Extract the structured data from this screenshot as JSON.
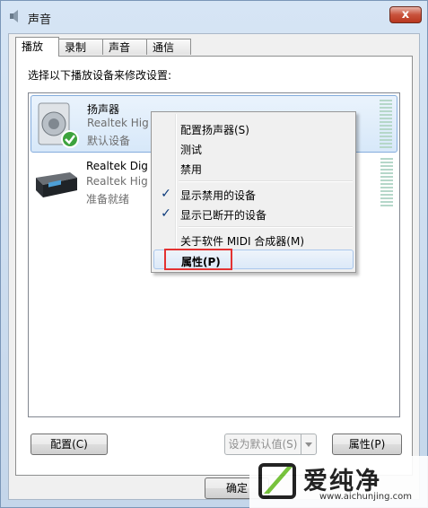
{
  "window": {
    "title": "声音",
    "close_label": "x"
  },
  "tabs": [
    {
      "label": "播放",
      "active": true
    },
    {
      "label": "录制",
      "active": false
    },
    {
      "label": "声音",
      "active": false
    },
    {
      "label": "通信",
      "active": false
    }
  ],
  "panel": {
    "instruction": "选择以下播放设备来修改设置:"
  },
  "devices": [
    {
      "name": "扬声器",
      "description": "Realtek Hig",
      "status": "默认设备",
      "selected": true,
      "icon": "speaker-icon"
    },
    {
      "name": "Realtek Dig",
      "description": "Realtek Hig",
      "status": "准备就绪",
      "selected": false,
      "icon": "digital-output-icon"
    }
  ],
  "context_menu": {
    "items": [
      {
        "label": "配置扬声器(S)",
        "checked": false
      },
      {
        "label": "测试",
        "checked": false
      },
      {
        "label": "禁用",
        "checked": false
      },
      {
        "label": "显示禁用的设备",
        "checked": true
      },
      {
        "label": "显示已断开的设备",
        "checked": true
      },
      {
        "label": "关于软件 MIDI 合成器(M)",
        "checked": false
      },
      {
        "label": "属性(P)",
        "checked": false,
        "highlighted": true
      }
    ]
  },
  "buttons": {
    "configure": "配置(C)",
    "set_default": "设为默认值(S)",
    "properties": "属性(P)",
    "ok": "确定"
  },
  "watermark": {
    "title": "爱纯净",
    "url": "www.aichunjing.com"
  },
  "colors": {
    "highlight_box": "#e33232",
    "check_mark": "#0c3a7a",
    "default_badge": "#3da33d"
  }
}
